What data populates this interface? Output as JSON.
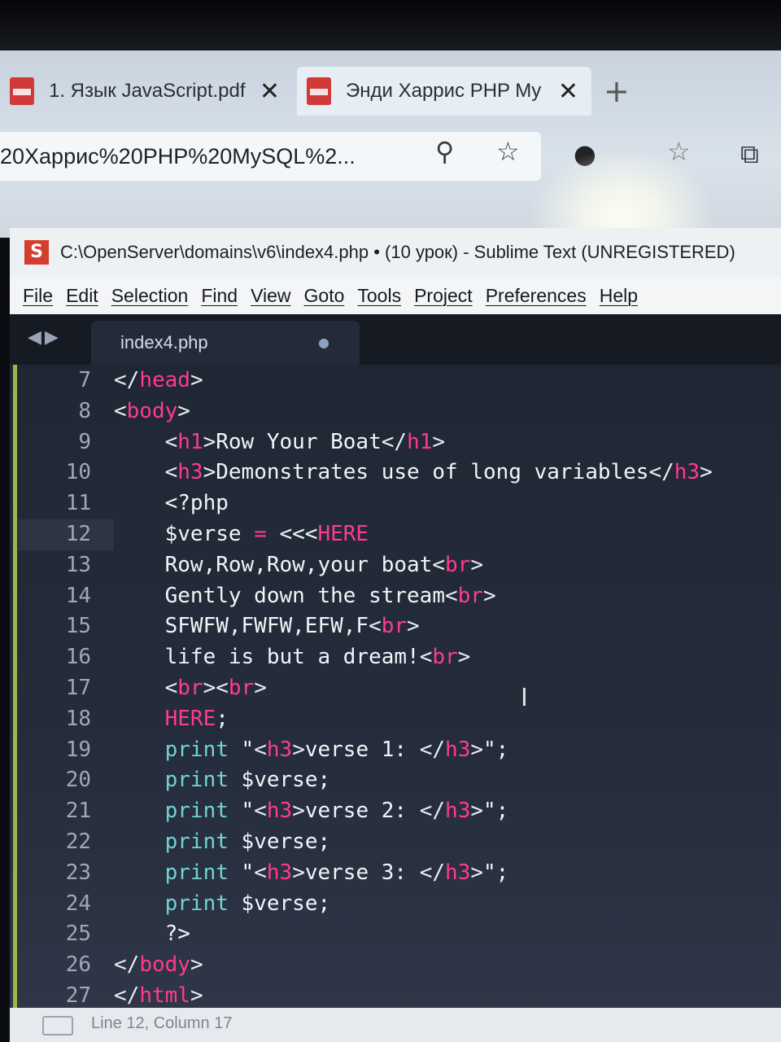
{
  "browser": {
    "tabs": [
      {
        "label": "1. Язык JavaScript.pdf",
        "close": "✕",
        "icon": "pdf-icon"
      },
      {
        "label": "Энди Харрис PHP My",
        "close": "✕",
        "icon": "pdf-icon"
      }
    ],
    "new_tab": "+",
    "address": "20Харрис%20PHP%20MySQL%2..."
  },
  "sublime": {
    "title": "C:\\OpenServer\\domains\\v6\\index4.php • (10 урок) - Sublime Text (UNREGISTERED)",
    "menu": [
      "File",
      "Edit",
      "Selection",
      "Find",
      "View",
      "Goto",
      "Tools",
      "Project",
      "Preferences",
      "Help"
    ],
    "tab_label": "index4.php",
    "status": "Line 12, Column 17"
  },
  "code_lines": [
    {
      "n": "7",
      "text": "</head>"
    },
    {
      "n": "8",
      "text": "<body>"
    },
    {
      "n": "9",
      "text": "    <h1>Row Your Boat</h1>"
    },
    {
      "n": "10",
      "text": "    <h3>Demonstrates use of long variables</h3>"
    },
    {
      "n": "11",
      "text": "    <?php"
    },
    {
      "n": "12",
      "text": "    $verse = <<<HERE"
    },
    {
      "n": "13",
      "text": "    Row,Row,Row,your boat<br>"
    },
    {
      "n": "14",
      "text": "    Gently down the stream<br>"
    },
    {
      "n": "15",
      "text": "    SFWFW,FWFW,EFW,F<br>"
    },
    {
      "n": "16",
      "text": "    life is but a dream!<br>"
    },
    {
      "n": "17",
      "text": "    <br><br>"
    },
    {
      "n": "18",
      "text": "    HERE;"
    },
    {
      "n": "19",
      "text": "    print \"<h3>verse 1: </h3>\";"
    },
    {
      "n": "20",
      "text": "    print $verse;"
    },
    {
      "n": "21",
      "text": "    print \"<h3>verse 2: </h3>\";"
    },
    {
      "n": "22",
      "text": "    print $verse;"
    },
    {
      "n": "23",
      "text": "    print \"<h3>verse 3: </h3>\";"
    },
    {
      "n": "24",
      "text": "    print $verse;"
    },
    {
      "n": "25",
      "text": "    ?>"
    },
    {
      "n": "26",
      "text": "</body>"
    },
    {
      "n": "27",
      "text": "</html>"
    }
  ]
}
